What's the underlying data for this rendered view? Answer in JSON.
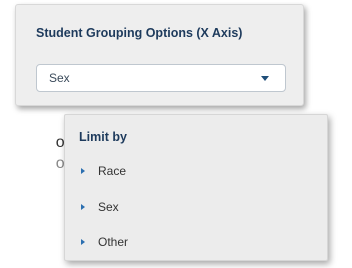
{
  "grouping": {
    "title": "Student Grouping Options (X Axis)",
    "selected": "Sex"
  },
  "background_text": {
    "line1": "or",
    "line2": "or"
  },
  "limit_by": {
    "title": "Limit by",
    "items": [
      {
        "label": "Race"
      },
      {
        "label": "Sex"
      },
      {
        "label": "Other"
      }
    ]
  }
}
